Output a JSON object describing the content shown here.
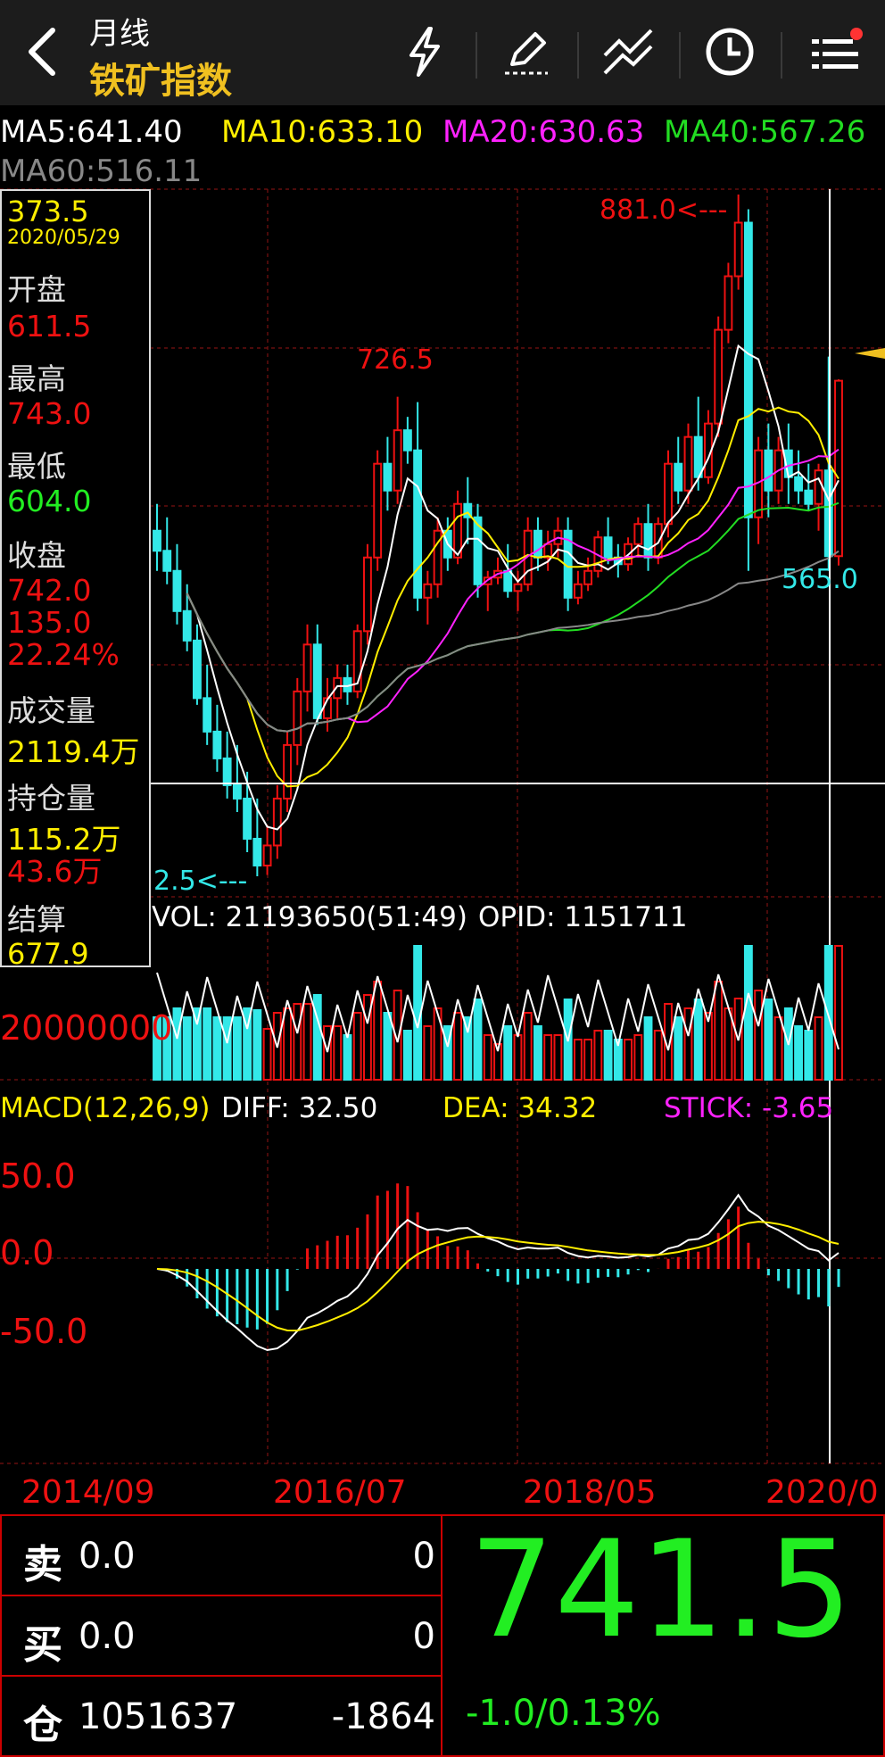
{
  "header": {
    "period": "月线",
    "title": "铁矿指数",
    "icons": [
      "back-icon",
      "lightning-icon",
      "pen-icon",
      "draw-line-icon",
      "clock-icon",
      "menu-icon"
    ]
  },
  "ma": {
    "ma5": "MA5:641.40",
    "ma10": "MA10:633.10",
    "ma20": "MA20:630.63",
    "ma40": "MA40:567.26",
    "ma60": "MA60:516.11"
  },
  "colors": {
    "ma5": "#ffffff",
    "ma10": "#ffee00",
    "ma20": "#ff22ff",
    "ma40": "#22dd22",
    "ma60": "#888888",
    "up": "#e11",
    "down": "#33e8e8",
    "accent": "#f0c020"
  },
  "info_panel": {
    "cursor_price": "373.5",
    "cursor_date": "2020/05/29",
    "open_label": "开盘",
    "open_value": "611.5",
    "high_label": "最高",
    "high_value": "743.0",
    "low_label": "最低",
    "low_value": "604.0",
    "close_label": "收盘",
    "close_value": "742.0",
    "change_value": "135.0",
    "change_pct": "22.24%",
    "volume_label": "成交量",
    "volume_value": "2119.4万",
    "oi_label": "持仓量",
    "oi_value": "115.2万",
    "oi_change": "43.6万",
    "settle_label": "结算",
    "settle_value": "677.9"
  },
  "main_annotations": {
    "high_mark": "881.0<---",
    "mid_mark": "726.5",
    "low_mark": "2.5<---",
    "ma40_mark": "565.0"
  },
  "volume_panel": {
    "vol_text": "VOL: 21193650(51:49)",
    "opid_text": "OPID: 1151711",
    "scale_label": "20000000"
  },
  "macd_panel": {
    "title": "MACD(12,26,9)",
    "diff": "DIFF: 32.50",
    "dea": "DEA: 34.32",
    "stick": "STICK: -3.65",
    "axis": [
      "50.0",
      "0.0",
      "-50.0"
    ]
  },
  "date_axis": [
    "2014/09",
    "2016/07",
    "2018/05",
    "2020/0"
  ],
  "quote": {
    "sell_label": "卖",
    "sell_price": "0.0",
    "sell_qty": "0",
    "buy_label": "买",
    "buy_price": "0.0",
    "buy_qty": "0",
    "oi_label": "仓",
    "oi_value": "1051637",
    "oi_change": "-1864",
    "last_price": "741.5",
    "change_text": "-1.0/0.13%"
  },
  "chart_data": {
    "type": "candlestick",
    "period": "monthly",
    "x_range": [
      "2013/10",
      "2020/05"
    ],
    "y_range": [
      360,
      885
    ],
    "candles": [
      [
        630,
        650,
        600,
        615
      ],
      [
        615,
        640,
        590,
        600
      ],
      [
        600,
        620,
        560,
        570
      ],
      [
        570,
        590,
        540,
        548
      ],
      [
        548,
        560,
        500,
        505
      ],
      [
        505,
        530,
        470,
        480
      ],
      [
        480,
        500,
        450,
        460
      ],
      [
        460,
        480,
        430,
        440
      ],
      [
        440,
        470,
        420,
        430
      ],
      [
        430,
        450,
        390,
        400
      ],
      [
        400,
        430,
        372,
        380
      ],
      [
        380,
        410,
        373,
        395
      ],
      [
        395,
        440,
        385,
        430
      ],
      [
        430,
        480,
        420,
        470
      ],
      [
        470,
        520,
        455,
        510
      ],
      [
        510,
        560,
        495,
        545
      ],
      [
        545,
        560,
        485,
        490
      ],
      [
        490,
        520,
        480,
        505
      ],
      [
        505,
        530,
        490,
        520
      ],
      [
        520,
        530,
        500,
        510
      ],
      [
        510,
        560,
        505,
        555
      ],
      [
        555,
        620,
        545,
        610
      ],
      [
        610,
        690,
        600,
        680
      ],
      [
        680,
        700,
        645,
        660
      ],
      [
        660,
        730,
        650,
        705
      ],
      [
        705,
        715,
        680,
        690
      ],
      [
        690,
        726,
        570,
        580
      ],
      [
        580,
        600,
        560,
        590
      ],
      [
        590,
        640,
        580,
        630
      ],
      [
        630,
        640,
        600,
        610
      ],
      [
        610,
        660,
        605,
        650
      ],
      [
        650,
        670,
        620,
        640
      ],
      [
        640,
        650,
        580,
        590
      ],
      [
        590,
        600,
        570,
        595
      ],
      [
        595,
        610,
        590,
        600
      ],
      [
        600,
        620,
        580,
        585
      ],
      [
        585,
        600,
        570,
        590
      ],
      [
        590,
        640,
        585,
        630
      ],
      [
        630,
        640,
        600,
        610
      ],
      [
        610,
        630,
        600,
        620
      ],
      [
        620,
        640,
        610,
        630
      ],
      [
        630,
        640,
        570,
        580
      ],
      [
        580,
        600,
        575,
        590
      ],
      [
        590,
        610,
        585,
        600
      ],
      [
        600,
        630,
        595,
        625
      ],
      [
        625,
        640,
        605,
        610
      ],
      [
        610,
        620,
        595,
        605
      ],
      [
        605,
        625,
        600,
        620
      ],
      [
        620,
        640,
        610,
        635
      ],
      [
        635,
        650,
        600,
        610
      ],
      [
        610,
        640,
        605,
        635
      ],
      [
        635,
        690,
        625,
        680
      ],
      [
        680,
        700,
        650,
        660
      ],
      [
        660,
        710,
        650,
        700
      ],
      [
        700,
        730,
        660,
        670
      ],
      [
        670,
        720,
        665,
        710
      ],
      [
        710,
        790,
        700,
        780
      ],
      [
        780,
        830,
        770,
        820
      ],
      [
        820,
        881,
        810,
        860
      ],
      [
        860,
        870,
        600,
        640
      ],
      [
        640,
        700,
        620,
        690
      ],
      [
        690,
        710,
        640,
        660
      ],
      [
        660,
        700,
        650,
        690
      ],
      [
        690,
        710,
        650,
        670
      ],
      [
        670,
        690,
        650,
        660
      ],
      [
        660,
        680,
        645,
        650
      ],
      [
        650,
        680,
        630,
        675
      ],
      [
        675,
        760,
        600,
        611
      ],
      [
        611,
        743,
        604,
        742
      ]
    ],
    "series": [
      {
        "name": "MA5",
        "values": []
      },
      {
        "name": "MA10",
        "values": []
      },
      {
        "name": "MA20",
        "values": []
      },
      {
        "name": "MA40",
        "values": []
      },
      {
        "name": "MA60",
        "values": []
      }
    ]
  }
}
